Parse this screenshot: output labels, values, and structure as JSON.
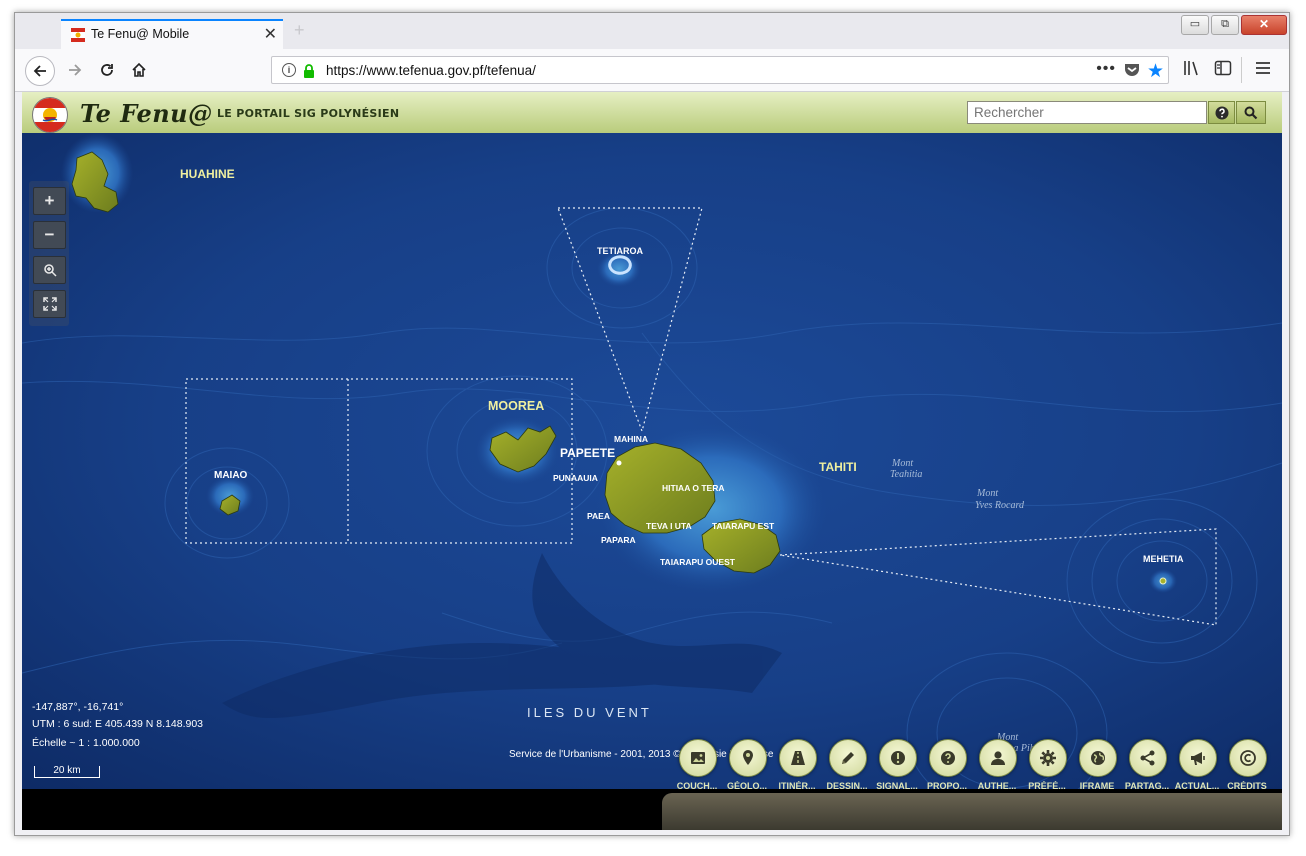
{
  "browser": {
    "tab_title": "Te Fenu@ Mobile",
    "tab_close": "✕",
    "new_tab": "+",
    "url": "https://www.tefenua.gov.pf/tefenua/",
    "url_actions": "•••",
    "window_controls": {
      "minimize": "▭",
      "restore": "⧉",
      "close": "✕"
    }
  },
  "app": {
    "brand": "Te Fenu@",
    "tagline": "LE PORTAIL SIG POLYNÉSIEN",
    "search_placeholder": "Rechercher"
  },
  "map": {
    "zoom_in": "+",
    "zoom_out": "−",
    "labels": {
      "huahine": "HUAHINE",
      "tetiaroa": "TETIAROA",
      "moorea": "MOOREA",
      "maiao": "MAIAO",
      "mahina": "MAHINA",
      "papeete": "PAPEETE",
      "punaauia": "PUNAAUIA",
      "hitiaa": "HITIAA O TERA",
      "paea": "PAEA",
      "teva": "TEVA I UTA",
      "taiarapu_est": "TAIARAPU EST",
      "papara": "PAPARA",
      "taiarapu_ouest": "TAIARAPU OUEST",
      "tahiti": "TAHITI",
      "mont_teahitia_1": "Mont",
      "mont_teahitia_2": "Teahitia",
      "mont_yves_1": "Mont",
      "mont_yves_2": "Yves Rocard",
      "mehetia": "MEHETIA",
      "iles_du_vent": "ILES DU VENT",
      "mont_moua_1": "Mont",
      "mont_moua_2": "Moua Pihaa"
    },
    "coord_lonlat": "-147,887°, -16,741°",
    "coord_utm": "UTM : 6 sud: E 405.439 N 8.148.903",
    "scale_ratio": "Échelle ~ 1 : 1.000.000",
    "scale_bar": "20 km",
    "attribution": "Service de l'Urbanisme - 2001, 2013 © Polynésie Française"
  },
  "toolbar": {
    "items": [
      {
        "label": "COUCH...",
        "icon": "image-icon"
      },
      {
        "label": "GÉOLO...",
        "icon": "location-pin-icon"
      },
      {
        "label": "ITINÉR...",
        "icon": "road-icon"
      },
      {
        "label": "DESSIN...",
        "icon": "pencil-icon"
      },
      {
        "label": "SIGNAL...",
        "icon": "exclamation-icon"
      },
      {
        "label": "PROPO...",
        "icon": "question-icon"
      },
      {
        "label": "AUTHE...",
        "icon": "user-icon"
      },
      {
        "label": "PRÉFÉ...",
        "icon": "gear-icon"
      },
      {
        "label": "IFRAME",
        "icon": "globe-icon"
      },
      {
        "label": "PARTAG...",
        "icon": "share-icon"
      },
      {
        "label": "ACTUAL...",
        "icon": "megaphone-icon"
      },
      {
        "label": "CRÉDITS",
        "icon": "copyright-icon"
      }
    ]
  }
}
